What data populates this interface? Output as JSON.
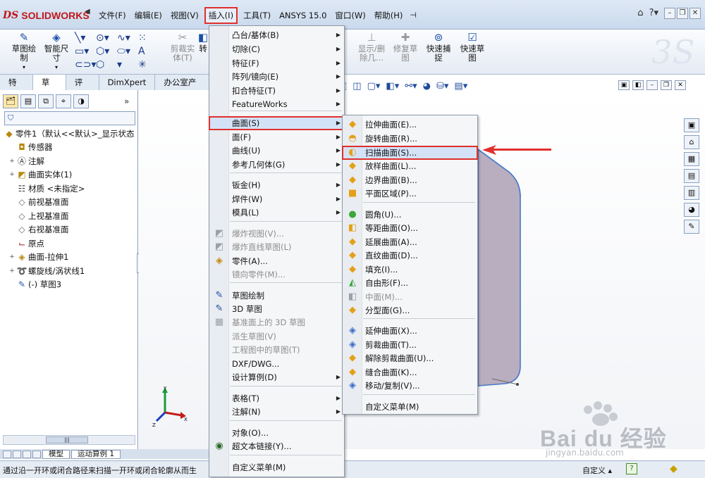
{
  "app": {
    "brand_ds": "DS",
    "brand_name": "SOLIDWORKS"
  },
  "menubar": {
    "items": [
      "文件(F)",
      "编辑(E)",
      "视图(V)",
      "插入(I)",
      "工具(T)",
      "ANSYS 15.0",
      "窗口(W)",
      "帮助(H)"
    ],
    "active": "插入(I)"
  },
  "ribbon": {
    "sketch": "草图绘\n制",
    "smart_dim": "智能尺\n寸",
    "trim": "剪裁实\n体(T)",
    "convert": "转",
    "show_relations": "显示/删\n除几...",
    "repair": "修复草\n图",
    "quick_snap": "快速捕\n捉",
    "quick_sketch": "快速草\n图"
  },
  "tabs": [
    "特征",
    "草图",
    "评估",
    "DimXpert",
    "办公室产品"
  ],
  "selected_tab": "草图",
  "tree": {
    "root": "零件1（默认<<默认>_显示状态",
    "items": [
      {
        "label": "传感器",
        "icon": "sensor-icon",
        "expand": ""
      },
      {
        "label": "注解",
        "icon": "annotation-icon",
        "expand": "+"
      },
      {
        "label": "曲面实体(1)",
        "icon": "surface-body-icon",
        "expand": "+"
      },
      {
        "label": "材质 <未指定>",
        "icon": "material-icon",
        "expand": ""
      },
      {
        "label": "前视基准面",
        "icon": "plane-icon",
        "expand": ""
      },
      {
        "label": "上视基准面",
        "icon": "plane-icon",
        "expand": ""
      },
      {
        "label": "右视基准面",
        "icon": "plane-icon",
        "expand": ""
      },
      {
        "label": "原点",
        "icon": "origin-icon",
        "expand": ""
      },
      {
        "label": "曲面-拉伸1",
        "icon": "extrude-surface-icon",
        "expand": "+"
      },
      {
        "label": "螺旋线/涡状线1",
        "icon": "helix-icon",
        "expand": "+"
      },
      {
        "label": "(-) 草图3",
        "icon": "sketch-icon",
        "expand": ""
      }
    ]
  },
  "bottom_tabs": [
    "模型",
    "运动算例 1"
  ],
  "status": {
    "text": "通过沿一开环或闭合路径来扫描一开环或闭合轮廓从而生",
    "mode": "自定义"
  },
  "insert_menu": {
    "items": [
      {
        "label": "凸台/基体(B)",
        "arrow": true
      },
      {
        "label": "切除(C)",
        "arrow": true
      },
      {
        "label": "特征(F)",
        "arrow": true
      },
      {
        "label": "阵列/镜向(E)",
        "arrow": true
      },
      {
        "label": "扣合特征(T)",
        "arrow": true
      },
      {
        "label": "FeatureWorks",
        "arrow": true
      },
      {
        "label": "曲面(S)",
        "arrow": true,
        "highlight": true
      },
      {
        "label": "面(F)",
        "arrow": true
      },
      {
        "label": "曲线(U)",
        "arrow": true
      },
      {
        "label": "参考几何体(G)",
        "arrow": true
      },
      {
        "label": "钣金(H)",
        "arrow": true
      },
      {
        "label": "焊件(W)",
        "arrow": true
      },
      {
        "label": "模具(L)",
        "arrow": true
      },
      {
        "label": "爆炸视图(V)...",
        "disabled": true
      },
      {
        "label": "爆炸直线草图(L)",
        "disabled": true
      },
      {
        "label": "零件(A)..."
      },
      {
        "label": "镜向零件(M)...",
        "disabled": true
      },
      {
        "label": "草图绘制"
      },
      {
        "label": "3D 草图"
      },
      {
        "label": "基准面上的 3D 草图",
        "disabled": true
      },
      {
        "label": "派生草图(V)",
        "disabled": true
      },
      {
        "label": "工程图中的草图(T)",
        "disabled": true
      },
      {
        "label": "DXF/DWG..."
      },
      {
        "label": "设计算例(D)",
        "arrow": true
      },
      {
        "label": "表格(T)",
        "arrow": true
      },
      {
        "label": "注解(N)",
        "arrow": true
      },
      {
        "label": "对象(O)..."
      },
      {
        "label": "超文本链接(Y)..."
      },
      {
        "label": "自定义菜单(M)"
      }
    ]
  },
  "surface_menu": {
    "items": [
      {
        "label": "拉伸曲面(E)..."
      },
      {
        "label": "旋转曲面(R)..."
      },
      {
        "label": "扫描曲面(S)...",
        "highlight": true
      },
      {
        "label": "放样曲面(L)..."
      },
      {
        "label": "边界曲面(B)..."
      },
      {
        "label": "平面区域(P)..."
      },
      {
        "label": "圆角(U)..."
      },
      {
        "label": "等距曲面(O)..."
      },
      {
        "label": "延展曲面(A)..."
      },
      {
        "label": "直纹曲面(D)..."
      },
      {
        "label": "填充(I)..."
      },
      {
        "label": "自由形(F)..."
      },
      {
        "label": "中面(M)...",
        "disabled": true
      },
      {
        "label": "分型面(G)..."
      },
      {
        "label": "延伸曲面(X)..."
      },
      {
        "label": "剪裁曲面(T)..."
      },
      {
        "label": "解除剪裁曲面(U)..."
      },
      {
        "label": "缝合曲面(K)..."
      },
      {
        "label": "移动/复制(V)..."
      },
      {
        "label": "自定义菜单(M)"
      }
    ]
  },
  "watermark": {
    "text": "Bai du 经验",
    "url": "jingyan.baidu.com"
  },
  "colors": {
    "accent_red": "#e0302c",
    "menu_highlight": "#d3e2f7",
    "shape_fill": "#b9aebf"
  }
}
